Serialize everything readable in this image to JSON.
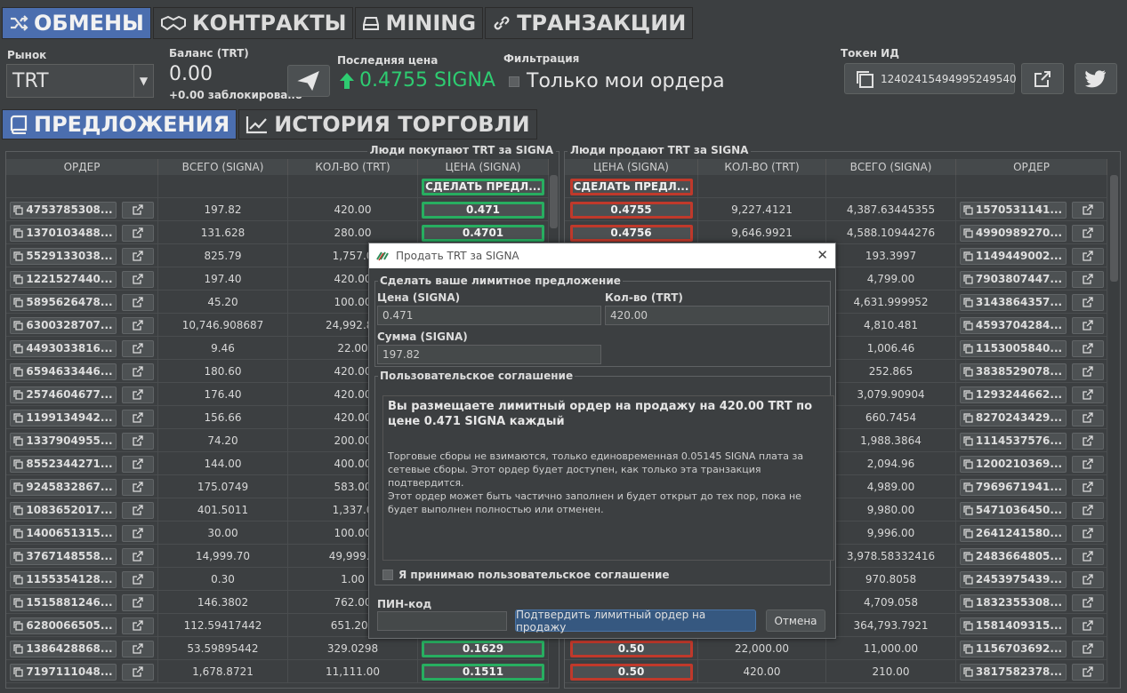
{
  "top_tabs": [
    {
      "label": "ОБМЕНЫ",
      "icon": "shuffle-icon"
    },
    {
      "label": "КОНТРАКТЫ",
      "icon": "handshake-icon"
    },
    {
      "label": "MINING",
      "icon": "hdd-icon"
    },
    {
      "label": "ТРАНЗАКЦИИ",
      "icon": "link-icon"
    }
  ],
  "header": {
    "market_label": "Рынок",
    "market_value": "TRT",
    "balance_label": "Баланс (TRT)",
    "balance_value": "0.00",
    "locked_text": "+0.00 заблокировано",
    "lastprice_label": "Последняя цена",
    "lastprice_value": "0.4755 SIGNA",
    "filter_label": "Фильтрация",
    "filter_option": "Только мои ордера",
    "token_label": "Токен ИД",
    "token_id": "12402415494995249540"
  },
  "sub_tabs": [
    {
      "label": "ПРЕДЛОЖЕНИЯ",
      "icon": "book-icon"
    },
    {
      "label": "ИСТОРИЯ ТОРГОВЛИ",
      "icon": "line-chart-icon"
    }
  ],
  "buy_panel": {
    "title": "Люди покупают TRT за SIGNA",
    "columns": [
      "ОРДЕР",
      "ВСЕГО (SIGNA)",
      "КОЛ-ВО (TRT)",
      "ЦЕНА (SIGNA)"
    ],
    "make_offer": "СДЕЛАТЬ ПРЕДЛ...",
    "rows": [
      {
        "order": "4753785308...",
        "total": "197.82",
        "qty": "420.00",
        "price": "0.471"
      },
      {
        "order": "1370103488...",
        "total": "131.628",
        "qty": "280.00",
        "price": "0.4701"
      },
      {
        "order": "5529133038...",
        "total": "825.79",
        "qty": "1,757.0",
        "price": ""
      },
      {
        "order": "1221527440...",
        "total": "197.40",
        "qty": "420.00",
        "price": ""
      },
      {
        "order": "5895626478...",
        "total": "45.20",
        "qty": "100.00",
        "price": ""
      },
      {
        "order": "6300328707...",
        "total": "10,746.908687",
        "qty": "24,992.81",
        "price": ""
      },
      {
        "order": "4493033816...",
        "total": "9.46",
        "qty": "22.00",
        "price": ""
      },
      {
        "order": "6594633446...",
        "total": "180.60",
        "qty": "420.00",
        "price": ""
      },
      {
        "order": "2574604677...",
        "total": "176.40",
        "qty": "420.00",
        "price": ""
      },
      {
        "order": "1199134942...",
        "total": "156.66",
        "qty": "420.00",
        "price": ""
      },
      {
        "order": "1337904955...",
        "total": "74.20",
        "qty": "200.00",
        "price": ""
      },
      {
        "order": "8552344271...",
        "total": "144.00",
        "qty": "400.00",
        "price": ""
      },
      {
        "order": "9245832867...",
        "total": "175.0749",
        "qty": "583.00",
        "price": ""
      },
      {
        "order": "1083652017...",
        "total": "401.5011",
        "qty": "1,337.0",
        "price": ""
      },
      {
        "order": "1400651315...",
        "total": "30.00",
        "qty": "100.00",
        "price": ""
      },
      {
        "order": "3767148558...",
        "total": "14,999.70",
        "qty": "49,999.0",
        "price": ""
      },
      {
        "order": "1155354128...",
        "total": "0.30",
        "qty": "1.00",
        "price": ""
      },
      {
        "order": "1515881246...",
        "total": "146.3802",
        "qty": "762.00",
        "price": ""
      },
      {
        "order": "6280066505...",
        "total": "112.59417442",
        "qty": "651.209",
        "price": ""
      },
      {
        "order": "1386428868...",
        "total": "53.59895442",
        "qty": "329.0298",
        "price": "0.1629"
      },
      {
        "order": "7197111048...",
        "total": "1,678.8721",
        "qty": "11,111.00",
        "price": "0.1511"
      }
    ]
  },
  "sell_panel": {
    "title": "Люди продают TRT за SIGNA",
    "columns": [
      "ЦЕНА (SIGNA)",
      "КОЛ-ВО (TRT)",
      "ВСЕГО (SIGNA)",
      "ОРДЕР"
    ],
    "make_offer": "СДЕЛАТЬ ПРЕДЛ...",
    "rows": [
      {
        "price": "0.4755",
        "qty": "9,227.4121",
        "total": "4,387.63445355",
        "order": "1570531141..."
      },
      {
        "price": "0.4756",
        "qty": "9,646.9921",
        "total": "4,588.10944276",
        "order": "4990989270..."
      },
      {
        "price": "",
        "qty": "",
        "total": "193.3997",
        "order": "1149449002..."
      },
      {
        "price": "",
        "qty": "",
        "total": "4,799.00",
        "order": "7903807447..."
      },
      {
        "price": "",
        "qty": "",
        "total": "4,631.999952",
        "order": "3143864357..."
      },
      {
        "price": "",
        "qty": "",
        "total": "4,810.481",
        "order": "4593704284..."
      },
      {
        "price": "",
        "qty": "",
        "total": "1,006.46",
        "order": "1153005840..."
      },
      {
        "price": "",
        "qty": "",
        "total": "252.865",
        "order": "3838529078..."
      },
      {
        "price": "",
        "qty": "",
        "total": "3,079.90904",
        "order": "1293244662..."
      },
      {
        "price": "",
        "qty": "",
        "total": "660.7454",
        "order": "8270243429..."
      },
      {
        "price": "",
        "qty": "",
        "total": "1,988.3864",
        "order": "1114537576..."
      },
      {
        "price": "",
        "qty": "",
        "total": "2,094.96",
        "order": "1200210369..."
      },
      {
        "price": "",
        "qty": "",
        "total": "4,989.00",
        "order": "7969671941..."
      },
      {
        "price": "",
        "qty": "",
        "total": "9,980.00",
        "order": "5471036450..."
      },
      {
        "price": "",
        "qty": "",
        "total": "9,996.00",
        "order": "2641241580..."
      },
      {
        "price": "",
        "qty": "",
        "total": "3,978.58332416",
        "order": "2483664805..."
      },
      {
        "price": "",
        "qty": "",
        "total": "970.8058",
        "order": "2453975439..."
      },
      {
        "price": "",
        "qty": "",
        "total": "4,709.058",
        "order": "1832355308..."
      },
      {
        "price": "",
        "qty": "",
        "total": "364,793.7921",
        "order": "1581409315..."
      },
      {
        "price": "0.50",
        "qty": "22,000.00",
        "total": "11,000.00",
        "order": "1156703692..."
      },
      {
        "price": "0.50",
        "qty": "420.00",
        "total": "210.00",
        "order": "3817582378..."
      }
    ]
  },
  "dialog": {
    "title": "Продать TRT за SIGNA",
    "group_title": "Сделать ваше лимитное предложение",
    "price_label": "Цена (SIGNA)",
    "price_value": "0.471",
    "qty_label": "Кол-во (TRT)",
    "qty_value": "420.00",
    "sum_label": "Сумма (SIGNA)",
    "sum_value": "197.82",
    "agreement_title": "Пользовательское соглашение",
    "agreement_heading": "Вы размещаете лимитный ордер на продажу на 420.00 TRT по цене 0.471 SIGNA каждый",
    "agreement_p1": "Торговые сборы не взимаются, только единовременная 0.05145 SIGNA плата за сетевые сборы. Этот ордер будет доступен, как только эта транзакция подтвердится.",
    "agreement_p2": "Этот ордер может быть частично заполнен и будет открыт до тех пор, пока не будет выполнен полностью или отменен.",
    "accept_label": "Я принимаю пользовательское соглашение",
    "pin_label": "ПИН-код",
    "pin_value": "",
    "confirm_label": "Подтвердить лимитный ордер на продажу",
    "cancel_label": "Отмена"
  },
  "colors": {
    "accent": "#4b6eaf",
    "buy": "#27ae60",
    "sell": "#c0392b",
    "up": "#2ecc71"
  }
}
